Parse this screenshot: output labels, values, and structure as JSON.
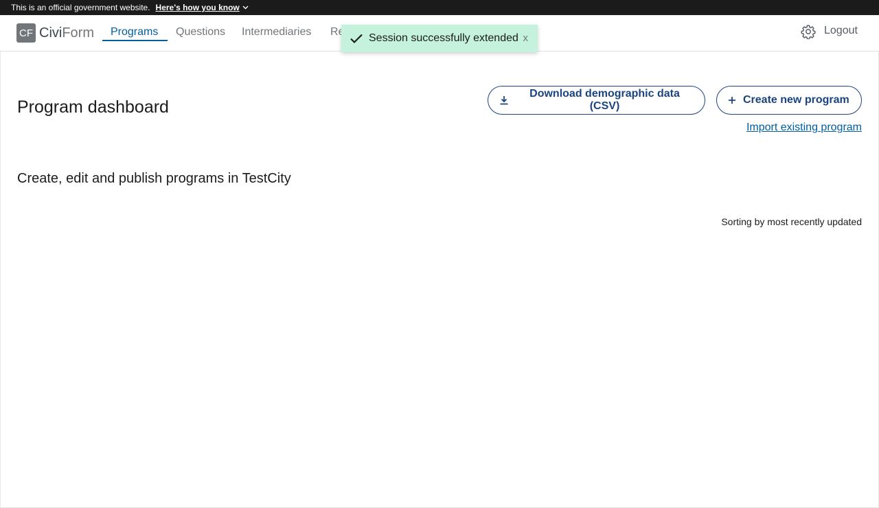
{
  "gov_banner": {
    "text": "This is an official government website.",
    "link": "Here's how you know",
    "chevron_icon": "chevron-down-icon"
  },
  "header": {
    "logo_initials": "CF",
    "logo_part1": "Civi",
    "logo_part2": "Form",
    "nav": [
      {
        "label": "Programs",
        "active": true
      },
      {
        "label": "Questions",
        "active": false
      },
      {
        "label": "Intermediaries",
        "active": false
      },
      {
        "label": "Reporting",
        "active": false
      }
    ],
    "settings_icon": "gear-icon",
    "logout": "Logout"
  },
  "toast": {
    "icon": "check-icon",
    "message": "Session successfully extended",
    "close": "x",
    "background": "#c4f2dd"
  },
  "main": {
    "title": "Program dashboard",
    "download_button": "Download demographic data (CSV)",
    "create_button": "Create new program",
    "import_link": "Import existing program",
    "subtitle": "Create, edit and publish programs in TestCity",
    "sorting": "Sorting by most recently updated"
  },
  "colors": {
    "accent": "#005ea2",
    "button_border": "#1a4480",
    "banner_bg": "#1b1b1b"
  }
}
